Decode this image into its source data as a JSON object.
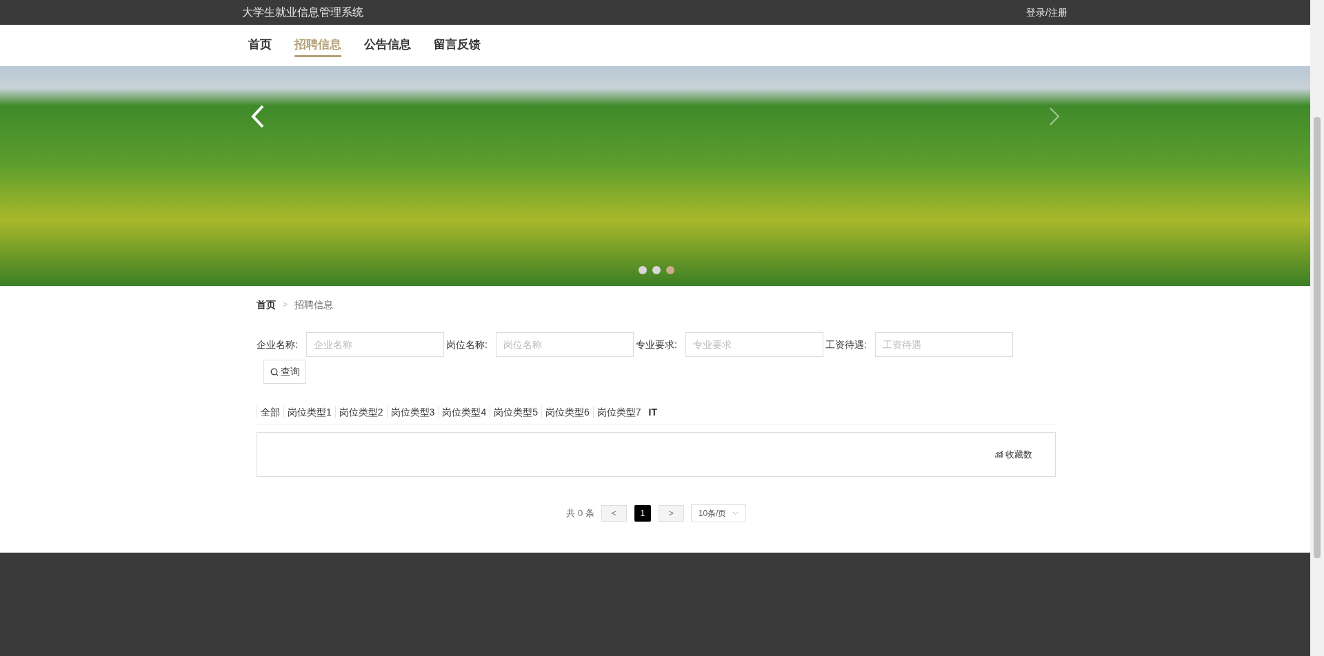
{
  "header": {
    "site_title": "大学生就业信息管理系统",
    "login_link": "登录/注册"
  },
  "nav": [
    {
      "label": "首页",
      "selected": false
    },
    {
      "label": "招聘信息",
      "selected": true
    },
    {
      "label": "公告信息",
      "selected": false
    },
    {
      "label": "留言反馈",
      "selected": false
    }
  ],
  "banner": {
    "dots": [
      {
        "selected": false
      },
      {
        "selected": false
      },
      {
        "selected": true
      }
    ]
  },
  "breadcrumb": [
    "首页",
    "招聘信息"
  ],
  "breadcrumb_separator": ">",
  "search": {
    "fields": [
      {
        "label": "企业名称:",
        "placeholder": "企业名称"
      },
      {
        "label": "岗位名称:",
        "placeholder": "岗位名称"
      },
      {
        "label": "专业要求:",
        "placeholder": "专业要求"
      },
      {
        "label": "工资待遇:",
        "placeholder": "工资待遇"
      }
    ],
    "button": "查询"
  },
  "categories": [
    {
      "label": "全部",
      "selected": false
    },
    {
      "label": "岗位类型1",
      "selected": false
    },
    {
      "label": "岗位类型2",
      "selected": false
    },
    {
      "label": "岗位类型3",
      "selected": false
    },
    {
      "label": "岗位类型4",
      "selected": false
    },
    {
      "label": "岗位类型5",
      "selected": false
    },
    {
      "label": "岗位类型6",
      "selected": false
    },
    {
      "label": "岗位类型7",
      "selected": false
    },
    {
      "label": "IT",
      "selected": true
    }
  ],
  "sort": {
    "label": "收藏数"
  },
  "pagination": {
    "total": "共 0 条",
    "prev": "<",
    "pages": [
      {
        "label": "1",
        "selected": true
      }
    ],
    "next": ">",
    "page_size": "10条/页"
  }
}
